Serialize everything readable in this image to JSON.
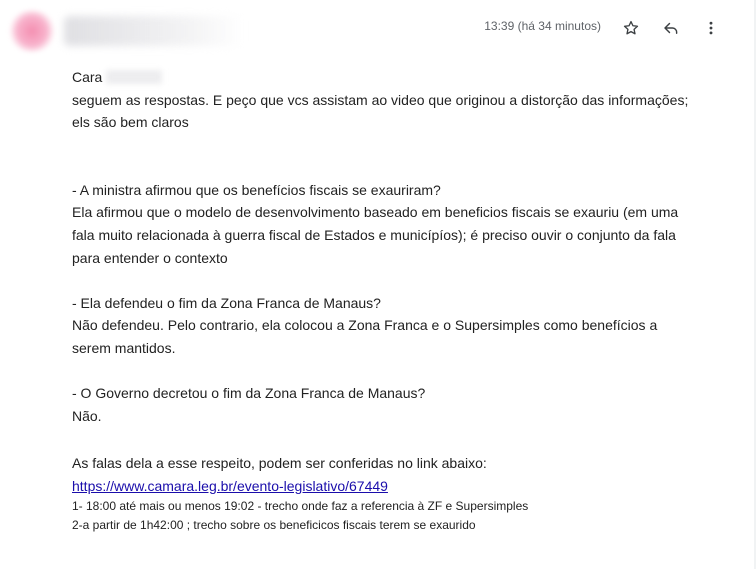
{
  "header": {
    "sender_name": "",
    "timestamp": "13:39 (há 34 minutos)",
    "icons": [
      "star-icon",
      "reply-icon",
      "more-vertical-icon"
    ]
  },
  "body": {
    "greeting": "Cara",
    "lines": [
      "seguem as respostas. E peço que vcs assistam ao video que originou a distorção das informações;",
      "els são bem claros"
    ],
    "qa": [
      {
        "question": "- A ministra afirmou que os benefícios fiscais se exauriram?",
        "answer": [
          "Ela afirmou que o modelo de desenvolvimento baseado em beneficios fiscais se exauriu (em uma",
          "fala muito relacionada à guerra fiscal de Estados e municípíos); é preciso ouvir o conjunto da fala",
          "para entender o contexto"
        ]
      },
      {
        "question": "- Ela defendeu o fim da Zona Franca de Manaus?",
        "answer": [
          "Não defendeu. Pelo contrario, ela  colocou a Zona Franca e o Supersimples como benefícios a",
          "serem mantidos."
        ]
      },
      {
        "question": "- O Governo decretou o fim da Zona Franca de Manaus?",
        "answer": [
          "Não."
        ]
      }
    ],
    "closing": "As falas dela a esse respeito, podem ser conferidas no link abaixo:",
    "link": "https://www.camara.leg.br/evento-legislativo/67449",
    "notes": [
      "1- 18:00 até mais ou menos 19:02 - trecho onde faz a referencia à ZF e Supersimples",
      "2-a partir de 1h42:00 ; trecho sobre os beneficicos fiscais terem se exaurido"
    ]
  }
}
